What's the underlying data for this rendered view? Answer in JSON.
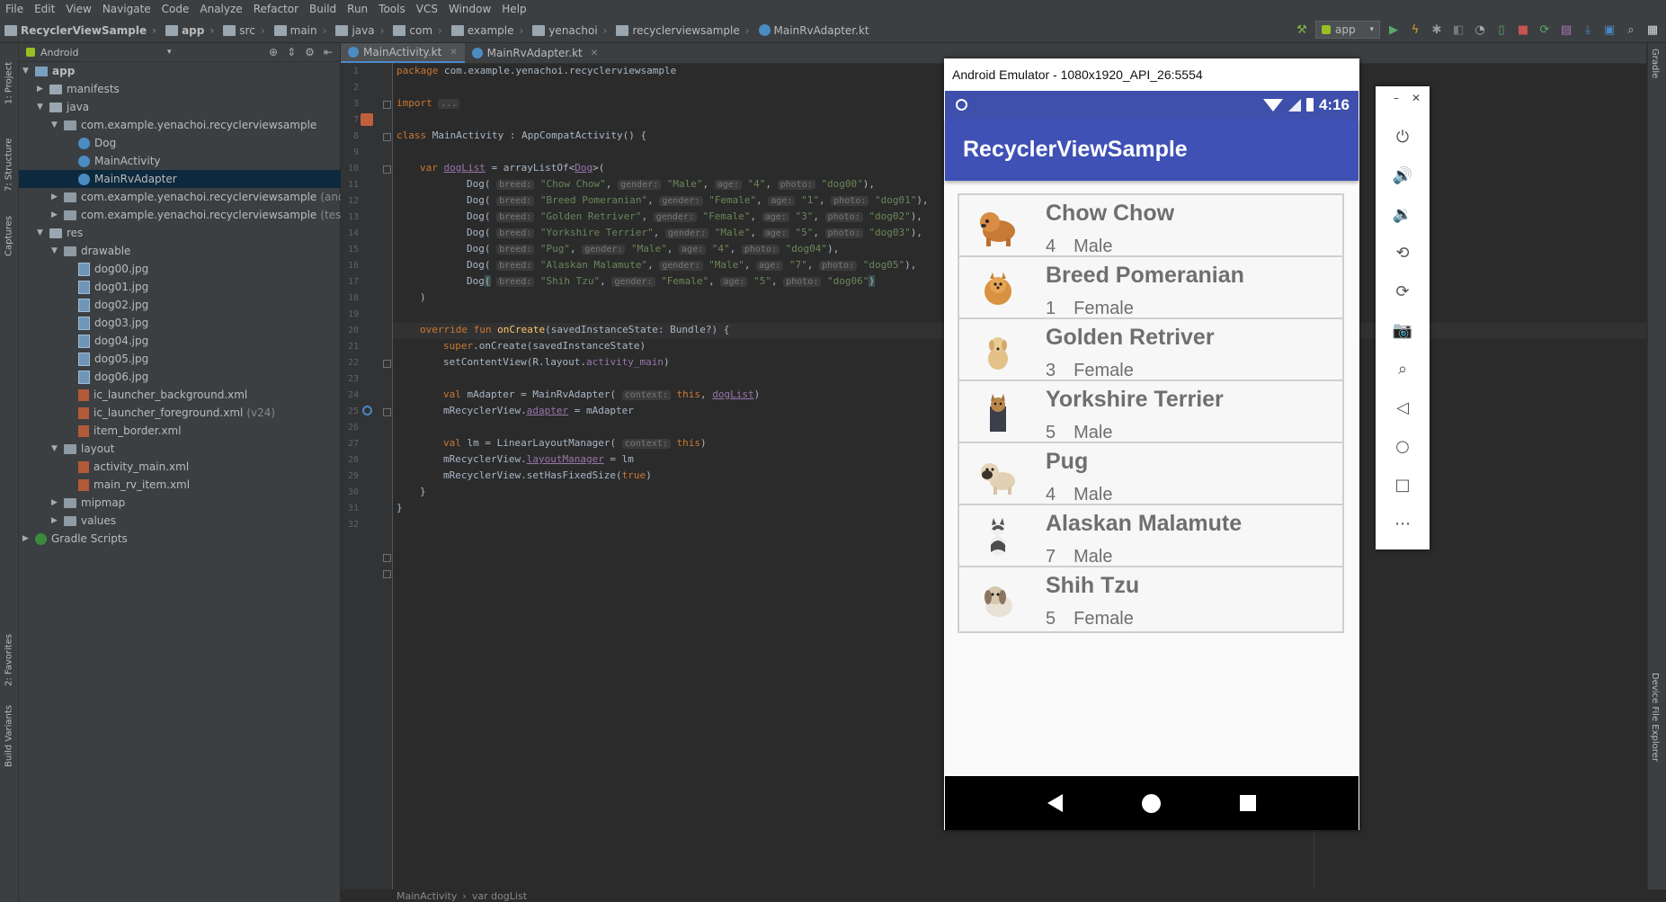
{
  "menu": [
    "File",
    "Edit",
    "View",
    "Navigate",
    "Code",
    "Analyze",
    "Refactor",
    "Build",
    "Run",
    "Tools",
    "VCS",
    "Window",
    "Help"
  ],
  "breadcrumbs": [
    "RecyclerViewSample",
    "app",
    "src",
    "main",
    "java",
    "com",
    "example",
    "yenachoi",
    "recyclerviewsample",
    "MainRvAdapter.kt"
  ],
  "run_config": "app",
  "project_panel": {
    "view_mode": "Android",
    "tree": [
      {
        "label": "app",
        "suffix": "",
        "bold": true
      },
      {
        "label": "manifests",
        "suffix": ""
      },
      {
        "label": "java",
        "suffix": ""
      },
      {
        "label": "com.example.yenachoi.recyclerviewsample",
        "suffix": ""
      },
      {
        "label": "Dog",
        "suffix": ""
      },
      {
        "label": "MainActivity",
        "suffix": ""
      },
      {
        "label": "MainRvAdapter",
        "suffix": ""
      },
      {
        "label": "com.example.yenachoi.recyclerviewsample",
        "suffix": "(androi"
      },
      {
        "label": "com.example.yenachoi.recyclerviewsample",
        "suffix": "(test)"
      },
      {
        "label": "res",
        "suffix": ""
      },
      {
        "label": "drawable",
        "suffix": ""
      },
      {
        "label": "dog00.jpg",
        "suffix": ""
      },
      {
        "label": "dog01.jpg",
        "suffix": ""
      },
      {
        "label": "dog02.jpg",
        "suffix": ""
      },
      {
        "label": "dog03.jpg",
        "suffix": ""
      },
      {
        "label": "dog04.jpg",
        "suffix": ""
      },
      {
        "label": "dog05.jpg",
        "suffix": ""
      },
      {
        "label": "dog06.jpg",
        "suffix": ""
      },
      {
        "label": "ic_launcher_background.xml",
        "suffix": ""
      },
      {
        "label": "ic_launcher_foreground.xml",
        "suffix": "(v24)"
      },
      {
        "label": "item_border.xml",
        "suffix": ""
      },
      {
        "label": "layout",
        "suffix": ""
      },
      {
        "label": "activity_main.xml",
        "suffix": ""
      },
      {
        "label": "main_rv_item.xml",
        "suffix": ""
      },
      {
        "label": "mipmap",
        "suffix": ""
      },
      {
        "label": "values",
        "suffix": ""
      },
      {
        "label": "Gradle Scripts",
        "suffix": ""
      }
    ]
  },
  "left_tool_tabs": [
    "1: Project",
    "7: Structure",
    "Captures",
    "2: Favorites",
    "Build Variants"
  ],
  "right_tool_tabs": [
    "Gradle",
    "Device File Explorer"
  ],
  "editor_tabs": [
    {
      "label": "MainActivity.kt",
      "active": true
    },
    {
      "label": "MainRvAdapter.kt",
      "active": false
    }
  ],
  "line_numbers": [
    "1",
    "2",
    "3",
    "7",
    "8",
    "9",
    "10",
    "11",
    "12",
    "13",
    "14",
    "15",
    "16",
    "17",
    "18",
    "19",
    "20",
    "21",
    "22",
    "23",
    "24",
    "25",
    "26",
    "27",
    "28",
    "29",
    "30",
    "31",
    "32"
  ],
  "code": {
    "package_kw": "package",
    "package_name": " com.example.yenachoi.recyclerviewsample",
    "import_kw": "import",
    "import_fold": "...",
    "class_kw": "class",
    "class_decl": " MainActivity : AppCompatActivity() {",
    "var_kw": "var",
    "doglist": "dogList",
    "eq_array": " = arrayListOf<",
    "dog_type": "Dog",
    "array_open": ">(",
    "param_breed": "breed:",
    "param_gender": "gender:",
    "param_age": "age:",
    "param_photo": "photo:",
    "dogs": [
      {
        "breed": "\"Chow Chow\"",
        "gender": "\"Male\"",
        "age": "\"4\"",
        "photo": "\"dog00\"",
        "end": "),"
      },
      {
        "breed": "\"Breed Pomeranian\"",
        "gender": "\"Female\"",
        "age": "\"1\"",
        "photo": "\"dog01\"",
        "end": "),"
      },
      {
        "breed": "\"Golden Retriver\"",
        "gender": "\"Female\"",
        "age": "\"3\"",
        "photo": "\"dog02\"",
        "end": "),"
      },
      {
        "breed": "\"Yorkshire Terrier\"",
        "gender": "\"Male\"",
        "age": "\"5\"",
        "photo": "\"dog03\"",
        "end": "),"
      },
      {
        "breed": "\"Pug\"",
        "gender": "\"Male\"",
        "age": "\"4\"",
        "photo": "\"dog04\"",
        "end": "),"
      },
      {
        "breed": "\"Alaskan Malamute\"",
        "gender": "\"Male\"",
        "age": "\"7\"",
        "photo": "\"dog05\"",
        "end": "),"
      },
      {
        "breed": "\"Shih Tzu\"",
        "gender": "\"Female\"",
        "age": "\"5\"",
        "photo": "\"dog06\"",
        "end": ")"
      }
    ],
    "close_paren": ")",
    "override_line": "override fun ",
    "oncreate": "onCreate",
    "oncreate_args": "(savedInstanceState: Bundle?) {",
    "super_kw": "super",
    "super_rest": ".onCreate(savedInstanceState)",
    "setcontent": "setContentView(R.layout.",
    "activity_main": "activity_main",
    "setcontent_end": ")",
    "val_kw": "val",
    "madapter_decl": " mAdapter = MainRvAdapter( ",
    "context_hint": "context:",
    "this_kw": "this",
    "madapter_end": ")",
    "rv_prefix": "mRecyclerView.",
    "adapter_prop": "adapter",
    "adapter_rest": " = mAdapter",
    "lm_decl": " lm = LinearLayoutManager( ",
    "lm_end": ")",
    "layout_manager_prop": "layoutManager",
    "lm_assign": " = lm",
    "fixed_size": "mRecyclerView.setHasFixedSize(",
    "true_kw": "true",
    "fixed_end": ")",
    "close_brace": "}"
  },
  "editor_breadcrumb": [
    "MainActivity",
    "var dogList"
  ],
  "emulator": {
    "title": "Android Emulator - 1080x1920_API_26:5554",
    "time": "4:16",
    "app_title": "RecyclerViewSample",
    "dogs": [
      {
        "breed": "Chow Chow",
        "age": "4",
        "gender": "Male"
      },
      {
        "breed": "Breed Pomeranian",
        "age": "1",
        "gender": "Female"
      },
      {
        "breed": "Golden Retriver",
        "age": "3",
        "gender": "Female"
      },
      {
        "breed": "Yorkshire Terrier",
        "age": "5",
        "gender": "Male"
      },
      {
        "breed": "Pug",
        "age": "4",
        "gender": "Male"
      },
      {
        "breed": "Alaskan Malamute",
        "age": "7",
        "gender": "Male"
      },
      {
        "breed": "Shih Tzu",
        "age": "5",
        "gender": "Female"
      }
    ],
    "side_controls": [
      "power-icon",
      "volume-up-icon",
      "volume-down-icon",
      "rotate-left-icon",
      "rotate-right-icon",
      "camera-icon",
      "zoom-icon",
      "back-icon",
      "home-icon",
      "overview-icon",
      "more-icon"
    ]
  }
}
